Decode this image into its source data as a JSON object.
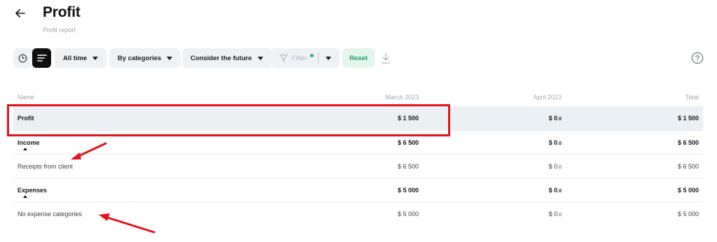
{
  "header": {
    "title": "Profit",
    "subtitle": "Profit report"
  },
  "toolbar": {
    "period_label": "All time",
    "grouping_label": "By categories",
    "future_label": "Consider the future",
    "filter_label": "Filter",
    "reset_label": "Reset",
    "accent_color": "#1bb87a"
  },
  "table": {
    "columns": [
      "Name",
      "March 2023",
      "April 2023",
      "Total"
    ],
    "rows": [
      {
        "name": "Profit",
        "march": "$ 1 500",
        "april_main": "$ 0",
        "april_dec": ".0",
        "total": "$ 1 500"
      },
      {
        "name": "Income",
        "march": "$ 6 500",
        "april_main": "$ 0",
        "april_dec": ".0",
        "total": "$ 6 500"
      },
      {
        "name": "Receipts from client",
        "march": "$ 6 500",
        "april_main": "$ 0",
        "april_dec": ".0",
        "total": "$ 6 500"
      },
      {
        "name": "Expenses",
        "march": "$ 5 000",
        "april_main": "$ 0",
        "april_dec": ".0",
        "total": "$ 5 000"
      },
      {
        "name": "No expense categories",
        "march": "$ 5 000",
        "april_main": "$ 0",
        "april_dec": ".0",
        "total": "$ 5 000"
      }
    ]
  },
  "annotations": {
    "color": "#e0141b"
  }
}
